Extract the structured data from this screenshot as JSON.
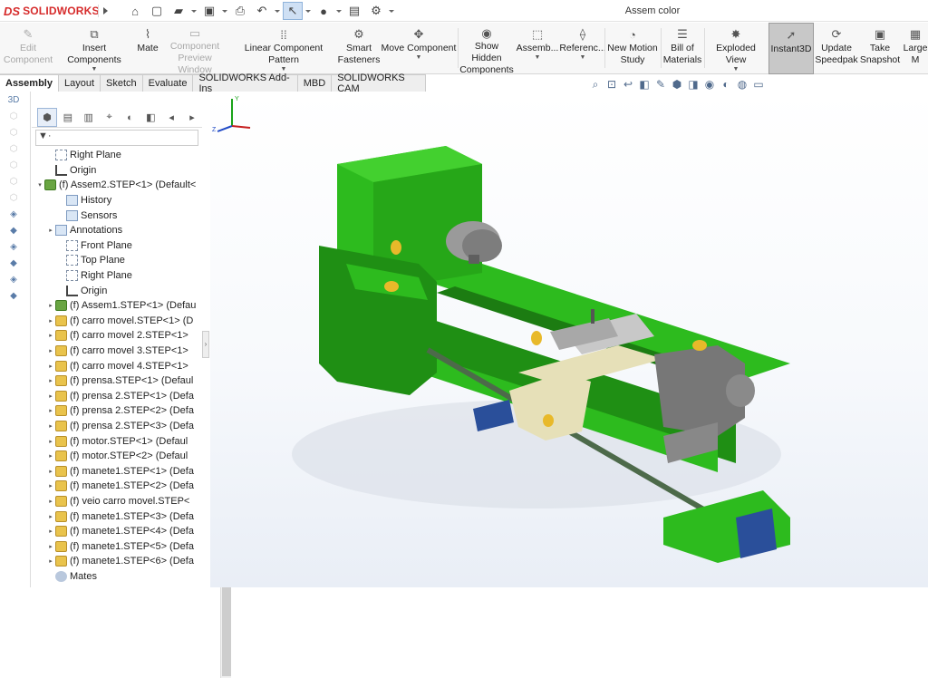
{
  "app": {
    "logo_ds": "DS",
    "logo_name": "SOLIDWORKS",
    "doc_title": "Assem color"
  },
  "quick_access": [
    {
      "icon": "home-icon",
      "glyph": "⌂"
    },
    {
      "icon": "new-file-icon",
      "glyph": "▢"
    },
    {
      "icon": "open-folder-icon",
      "glyph": "▰"
    },
    {
      "icon": "save-icon",
      "glyph": "▣"
    },
    {
      "icon": "print-icon",
      "glyph": "⎙"
    },
    {
      "icon": "undo-icon",
      "glyph": "↶"
    },
    {
      "icon": "select-arrow-icon",
      "glyph": "↖"
    },
    {
      "icon": "traffic-light-icon",
      "glyph": "●"
    },
    {
      "icon": "file-properties-icon",
      "glyph": "▤"
    },
    {
      "icon": "options-gear-icon",
      "glyph": "⚙"
    }
  ],
  "ribbon": {
    "edit_component": "Edit\nComponent",
    "insert_components": "Insert Components",
    "mate": "Mate",
    "component_preview": "Component\nPreview Window",
    "linear_pattern": "Linear Component Pattern",
    "smart_fasteners": "Smart\nFasteners",
    "move_component": "Move Component",
    "show_hidden": "Show Hidden\nComponents",
    "assembly": "Assemb...",
    "reference": "Referenc...",
    "new_motion": "New Motion\nStudy",
    "bom": "Bill of\nMaterials",
    "exploded": "Exploded View",
    "instant3d": "Instant3D",
    "speedpak": "Update\nSpeedpak",
    "snapshot": "Take\nSnapshot",
    "large": "Large\nM"
  },
  "tabs": [
    "Assembly",
    "Layout",
    "Sketch",
    "Evaluate",
    "SOLIDWORKS Add-Ins",
    "MBD",
    "SOLIDWORKS CAM"
  ],
  "filter": "▼·",
  "tree": [
    {
      "label": "Right Plane",
      "type": "plane",
      "indent": 1,
      "exp": ""
    },
    {
      "label": "Origin",
      "type": "origin",
      "indent": 1,
      "exp": ""
    },
    {
      "label": "(f) Assem2.STEP<1> (Default<",
      "type": "asm",
      "indent": 0,
      "exp": "▾"
    },
    {
      "label": "History",
      "type": "folder",
      "indent": 2,
      "exp": ""
    },
    {
      "label": "Sensors",
      "type": "folder",
      "indent": 2,
      "exp": ""
    },
    {
      "label": "Annotations",
      "type": "folder",
      "indent": 1,
      "exp": "▸"
    },
    {
      "label": "Front Plane",
      "type": "plane",
      "indent": 2,
      "exp": ""
    },
    {
      "label": "Top Plane",
      "type": "plane",
      "indent": 2,
      "exp": ""
    },
    {
      "label": "Right Plane",
      "type": "plane",
      "indent": 2,
      "exp": ""
    },
    {
      "label": "Origin",
      "type": "origin",
      "indent": 2,
      "exp": ""
    },
    {
      "label": "(f) Assem1.STEP<1> (Defau",
      "type": "asm",
      "indent": 1,
      "exp": "▸"
    },
    {
      "label": "(f) carro movel.STEP<1> (D",
      "type": "part",
      "indent": 1,
      "exp": "▸"
    },
    {
      "label": "(f) carro movel 2.STEP<1>",
      "type": "part",
      "indent": 1,
      "exp": "▸"
    },
    {
      "label": "(f) carro movel 3.STEP<1>",
      "type": "part",
      "indent": 1,
      "exp": "▸"
    },
    {
      "label": "(f) carro movel 4.STEP<1>",
      "type": "part",
      "indent": 1,
      "exp": "▸"
    },
    {
      "label": "(f) prensa.STEP<1> (Defaul",
      "type": "part",
      "indent": 1,
      "exp": "▸"
    },
    {
      "label": "(f) prensa 2.STEP<1> (Defa",
      "type": "part",
      "indent": 1,
      "exp": "▸"
    },
    {
      "label": "(f) prensa 2.STEP<2> (Defa",
      "type": "part",
      "indent": 1,
      "exp": "▸"
    },
    {
      "label": "(f) prensa 2.STEP<3> (Defa",
      "type": "part",
      "indent": 1,
      "exp": "▸"
    },
    {
      "label": "(f) motor.STEP<1> (Defaul",
      "type": "part",
      "indent": 1,
      "exp": "▸"
    },
    {
      "label": "(f) motor.STEP<2> (Defaul",
      "type": "part",
      "indent": 1,
      "exp": "▸"
    },
    {
      "label": "(f) manete1.STEP<1> (Defa",
      "type": "part",
      "indent": 1,
      "exp": "▸"
    },
    {
      "label": "(f) manete1.STEP<2> (Defa",
      "type": "part",
      "indent": 1,
      "exp": "▸"
    },
    {
      "label": "(f) veio carro movel.STEP<",
      "type": "part",
      "indent": 1,
      "exp": "▸"
    },
    {
      "label": "(f) manete1.STEP<3> (Defa",
      "type": "part",
      "indent": 1,
      "exp": "▸"
    },
    {
      "label": "(f) manete1.STEP<4> (Defa",
      "type": "part",
      "indent": 1,
      "exp": "▸"
    },
    {
      "label": "(f) manete1.STEP<5> (Defa",
      "type": "part",
      "indent": 1,
      "exp": "▸"
    },
    {
      "label": "(f) manete1.STEP<6> (Defa",
      "type": "part",
      "indent": 1,
      "exp": "▸"
    },
    {
      "label": "Mates",
      "type": "mates",
      "indent": 1,
      "exp": ""
    }
  ],
  "colors": {
    "bed_green": "#2dbb1e",
    "dark_green": "#1f8f14",
    "motor_blue": "#2a4f9a",
    "carriage_beige": "#e6e0b8",
    "chuck_gray": "#9a9a9a",
    "handle_gold": "#e8b92a"
  },
  "triad": {
    "y": "Y",
    "z": "Z"
  }
}
